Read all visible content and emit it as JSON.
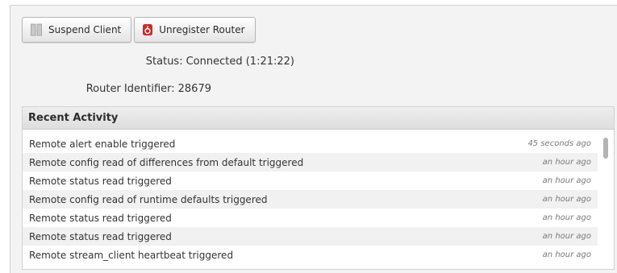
{
  "toolbar": {
    "suspend_label": "Suspend Client",
    "unregister_label": "Unregister Router"
  },
  "status": {
    "label": "Status:",
    "value": "Connected (1:21:22)"
  },
  "router": {
    "label": "Router Identifier:",
    "value": "28679"
  },
  "recent_activity": {
    "title": "Recent Activity",
    "items": [
      {
        "text": "Remote alert enable triggered",
        "time": "45 seconds ago"
      },
      {
        "text": "Remote config read of differences from default triggered",
        "time": "an hour ago"
      },
      {
        "text": "Remote status read triggered",
        "time": "an hour ago"
      },
      {
        "text": "Remote config read of runtime defaults triggered",
        "time": "an hour ago"
      },
      {
        "text": "Remote status read triggered",
        "time": "an hour ago"
      },
      {
        "text": "Remote status read triggered",
        "time": "an hour ago"
      },
      {
        "text": "Remote stream_client heartbeat triggered",
        "time": "an hour ago"
      }
    ]
  },
  "icons": {
    "suspend": "pause-icon",
    "unregister": "unregister-router-icon"
  },
  "colors": {
    "unregister_icon": "#d0282b",
    "panel_bg": "#f3f3f3",
    "row_alt": "#f1f1f1"
  }
}
